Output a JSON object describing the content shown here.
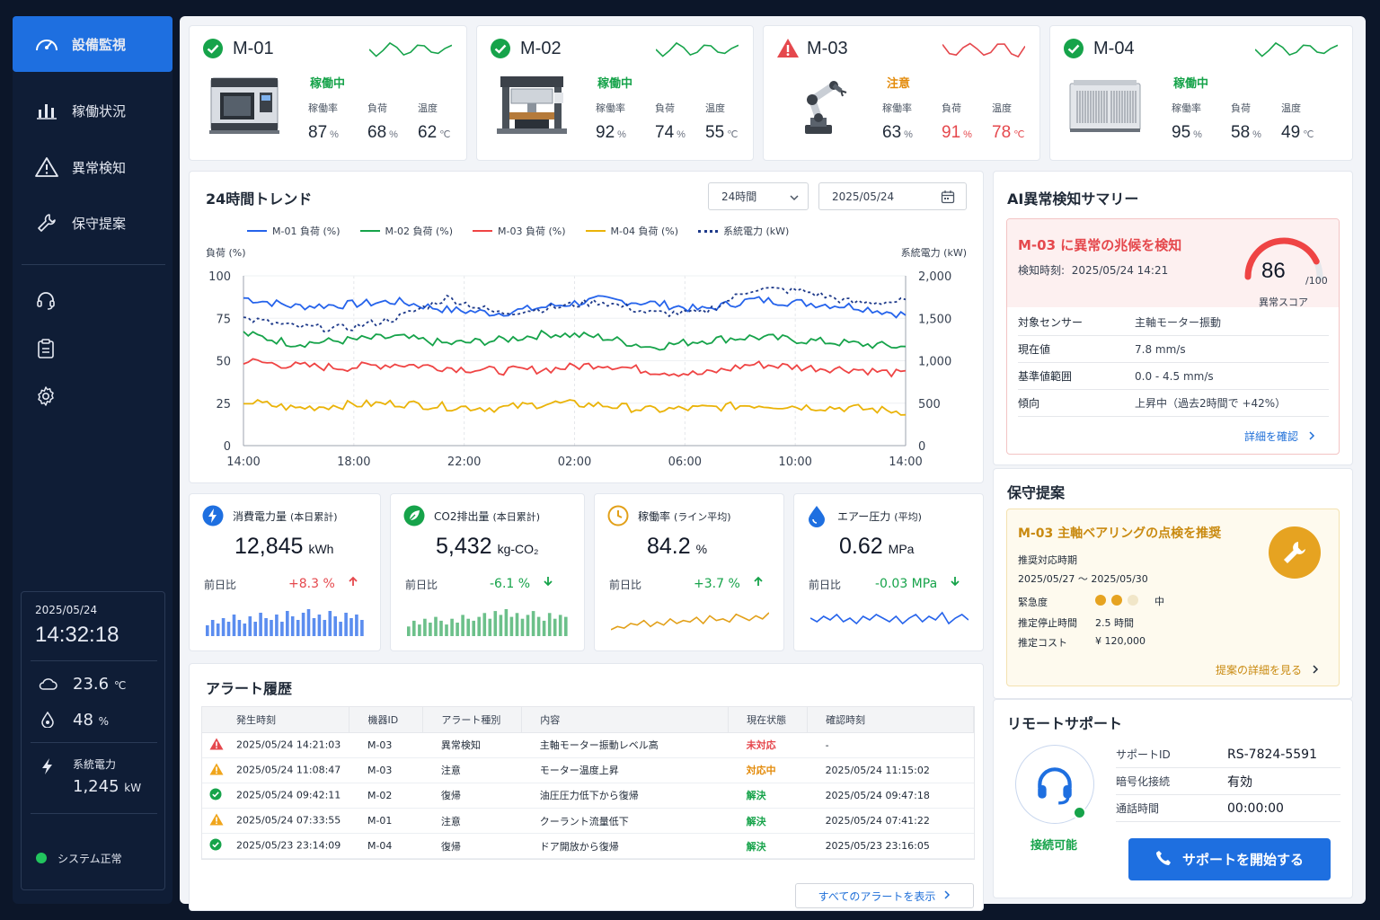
{
  "sidebar": {
    "nav": [
      {
        "label": "設備監視",
        "icon": "gauge-icon",
        "active": true
      },
      {
        "label": "稼働状況",
        "icon": "bar-chart-icon",
        "active": false
      },
      {
        "label": "異常検知",
        "icon": "warning-icon",
        "active": false
      },
      {
        "label": "保守提案",
        "icon": "wrench-icon",
        "active": false
      }
    ],
    "tools": [
      "headset-icon",
      "clipboard-icon",
      "gear-icon"
    ],
    "date": "2025/05/24",
    "time": "14:32:18",
    "temp_value": "23.6",
    "temp_unit": "℃",
    "humidity_value": "48",
    "humidity_unit": "%",
    "power_label": "系統電力",
    "power_value": "1,245",
    "power_unit": "kW",
    "system_status": "システム正常"
  },
  "machines": [
    {
      "id": "M-01",
      "status": "稼働中",
      "state": "ok",
      "utilization_label": "稼働率",
      "utilization": "87",
      "load_label": "負荷",
      "load": "68",
      "temp_label": "温度",
      "temp": "62",
      "pct": "%",
      "deg": "℃",
      "image": "cnc-machine"
    },
    {
      "id": "M-02",
      "status": "稼働中",
      "state": "ok",
      "utilization_label": "稼働率",
      "utilization": "92",
      "load_label": "負荷",
      "load": "74",
      "temp_label": "温度",
      "temp": "55",
      "pct": "%",
      "deg": "℃",
      "image": "press-machine"
    },
    {
      "id": "M-03",
      "status": "注意",
      "state": "warn",
      "utilization_label": "稼働率",
      "utilization": "63",
      "load_label": "負荷",
      "load": "91",
      "temp_label": "温度",
      "temp": "78",
      "pct": "%",
      "deg": "℃",
      "image": "robot-arm"
    },
    {
      "id": "M-04",
      "status": "稼働中",
      "state": "ok",
      "utilization_label": "稼働率",
      "utilization": "95",
      "load_label": "負荷",
      "load": "58",
      "temp_label": "温度",
      "temp": "49",
      "pct": "%",
      "deg": "℃",
      "image": "chiller-unit"
    }
  ],
  "trend": {
    "title": "24時間トレンド",
    "range_select": "24時間",
    "date_input": "2025/05/24",
    "left_axis_label": "負荷 (%)",
    "right_axis_label": "系統電力 (kW)",
    "legend": [
      "M-01 負荷 (%)",
      "M-02 負荷 (%)",
      "M-03 負荷 (%)",
      "M-04 負荷 (%)",
      "系統電力 (kW)"
    ],
    "left_ticks": [
      "100",
      "75",
      "50",
      "25",
      "0"
    ],
    "right_ticks": [
      "2,000",
      "1,500",
      "1,000",
      "500",
      "0"
    ],
    "x_ticks": [
      "14:00",
      "18:00",
      "22:00",
      "02:00",
      "06:00",
      "10:00",
      "14:00"
    ]
  },
  "chart_data": {
    "type": "line",
    "title": "24時間トレンド",
    "x": [
      "14:00",
      "18:00",
      "22:00",
      "02:00",
      "06:00",
      "10:00",
      "14:00"
    ],
    "ylabel": "負荷 (%)",
    "y2label": "系統電力 (kW)",
    "ylim": [
      0,
      100
    ],
    "y2lim": [
      0,
      2000
    ],
    "grid": true,
    "legend_position": "top",
    "series": [
      {
        "name": "M-01 負荷 (%)",
        "color": "#2563eb",
        "axis": "left",
        "values": [
          87,
          82,
          83,
          85,
          80,
          78,
          82,
          86,
          84,
          80,
          86,
          84,
          82,
          77
        ]
      },
      {
        "name": "M-02 負荷 (%)",
        "color": "#16a34a",
        "axis": "left",
        "values": [
          66,
          60,
          62,
          64,
          60,
          62,
          66,
          64,
          58,
          62,
          64,
          62,
          60,
          58
        ]
      },
      {
        "name": "M-03 負荷 (%)",
        "color": "#ef4444",
        "axis": "left",
        "values": [
          50,
          47,
          46,
          48,
          46,
          44,
          45,
          48,
          44,
          42,
          48,
          46,
          45,
          42
        ]
      },
      {
        "name": "M-04 負荷 (%)",
        "color": "#eab308",
        "axis": "left",
        "values": [
          26,
          22,
          24,
          25,
          23,
          22,
          25,
          24,
          21,
          22,
          24,
          23,
          22,
          20
        ]
      },
      {
        "name": "系統電力 (kW)",
        "color": "#1e3a8a",
        "axis": "right",
        "dashed": true,
        "values": [
          1500,
          1400,
          1380,
          1500,
          1740,
          1560,
          1620,
          1700,
          1560,
          1560,
          1850,
          1820,
          1680,
          1700
        ]
      }
    ]
  },
  "kpis": [
    {
      "title": "消費電力量",
      "sub": "(本日累計)",
      "value": "12,845",
      "unit": "kWh",
      "delta_label": "前日比",
      "delta": "+8.3 %",
      "dir": "up",
      "delta_color": "#e5484d",
      "icon": "bolt-icon",
      "icon_color": "#1e6fe0",
      "spark": "bars",
      "spark_color": "#5b8def",
      "spark_values": [
        6,
        9,
        7,
        10,
        8,
        12,
        9,
        7,
        11,
        8,
        13,
        10,
        9,
        12,
        8,
        14,
        11,
        9,
        13,
        15,
        10,
        12,
        9,
        14,
        11,
        8,
        13,
        10,
        12,
        9
      ]
    },
    {
      "title": "CO2排出量",
      "sub": "(本日累計)",
      "value": "5,432",
      "unit": "kg-CO₂",
      "delta_label": "前日比",
      "delta": "-6.1 %",
      "dir": "down",
      "delta_color": "#16a34a",
      "icon": "leaf-icon",
      "icon_color": "#16a34a",
      "spark": "bars",
      "spark_color": "#6cc08a",
      "spark_values": [
        5,
        8,
        6,
        9,
        7,
        10,
        8,
        6,
        9,
        7,
        11,
        9,
        8,
        10,
        12,
        9,
        13,
        11,
        14,
        10,
        12,
        9,
        11,
        13,
        10,
        8,
        12,
        9,
        11,
        10
      ]
    },
    {
      "title": "稼働率",
      "sub": "(ライン平均)",
      "value": "84.2",
      "unit": "%",
      "delta_label": "前日比",
      "delta": "+3.7 %",
      "dir": "up",
      "delta_color": "#16a34a",
      "icon": "clock-icon",
      "icon_color": "#e2a019",
      "spark": "line",
      "spark_color": "#e2a019",
      "spark_values": [
        3,
        5,
        4,
        7,
        6,
        9,
        5,
        8,
        6,
        10,
        7,
        9,
        8,
        11,
        7,
        12,
        9,
        10,
        8,
        13,
        11,
        9,
        12,
        10,
        14
      ]
    },
    {
      "title": "エアー圧力",
      "sub": "(平均)",
      "value": "0.62",
      "unit": "MPa",
      "delta_label": "前日比",
      "delta": "-0.03 MPa",
      "dir": "down",
      "delta_color": "#16a34a",
      "icon": "drop-icon",
      "icon_color": "#1e6fe0",
      "spark": "line",
      "spark_color": "#2563eb",
      "spark_values": [
        9,
        7,
        10,
        8,
        11,
        7,
        9,
        6,
        10,
        8,
        11,
        9,
        7,
        10,
        6,
        9,
        11,
        7,
        10,
        8,
        12,
        6,
        9,
        11,
        8
      ]
    }
  ],
  "alerts": {
    "title": "アラート履歴",
    "columns": [
      "発生時刻",
      "機器ID",
      "アラート種別",
      "内容",
      "現在状態",
      "確認時刻"
    ],
    "rows": [
      {
        "level": "error",
        "time": "2025/05/24 14:21:03",
        "id": "M-03",
        "type": "異常検知",
        "content": "主軸モーター振動レベル高",
        "state": "未対応",
        "state_color": "#e5484d",
        "confirmed": "-"
      },
      {
        "level": "warn",
        "time": "2025/05/24 11:08:47",
        "id": "M-03",
        "type": "注意",
        "content": "モーター温度上昇",
        "state": "対応中",
        "state_color": "#e38b0b",
        "confirmed": "2025/05/24 11:15:02"
      },
      {
        "level": "ok",
        "time": "2025/05/24 09:42:11",
        "id": "M-02",
        "type": "復帰",
        "content": "油圧圧力低下から復帰",
        "state": "解決",
        "state_color": "#16a34a",
        "confirmed": "2025/05/24 09:47:18"
      },
      {
        "level": "warn",
        "time": "2025/05/24 07:33:55",
        "id": "M-01",
        "type": "注意",
        "content": "クーラント流量低下",
        "state": "解決",
        "state_color": "#16a34a",
        "confirmed": "2025/05/24 07:41:22"
      },
      {
        "level": "ok",
        "time": "2025/05/23 23:14:09",
        "id": "M-04",
        "type": "復帰",
        "content": "ドア開放から復帰",
        "state": "解決",
        "state_color": "#16a34a",
        "confirmed": "2025/05/23 23:16:05"
      }
    ],
    "view_all": "すべてのアラートを表示"
  },
  "ai": {
    "title": "AI異常検知サマリー",
    "headline": "M-03 に異常の兆候を検知",
    "detect_label": "検知時刻:",
    "detect_time": "2025/05/24 14:21",
    "score": "86",
    "score_value": 86,
    "score_max": "/100",
    "score_label": "異常スコア",
    "rows": [
      {
        "k": "対象センサー",
        "v": "主軸モーター振動"
      },
      {
        "k": "現在値",
        "v": "7.8 mm/s"
      },
      {
        "k": "基準値範囲",
        "v": "0.0 - 4.5 mm/s"
      },
      {
        "k": "傾向",
        "v": "上昇中（過去2時間で +42%）"
      }
    ],
    "detail_link": "詳細を確認"
  },
  "maintenance": {
    "title": "保守提案",
    "headline": "M-03 主軸ベアリングの点検を推奨",
    "period_label": "推奨対応時期",
    "period": "2025/05/27 〜 2025/05/30",
    "urgency_label": "緊急度",
    "urgency_level": 2,
    "urgency_of": 3,
    "urgency_text": "中",
    "downtime_label": "推定停止時間",
    "downtime": "2.5 時間",
    "cost_label": "推定コスト",
    "cost": "¥ 120,000",
    "detail_link": "提案の詳細を見る"
  },
  "remote": {
    "title": "リモートサポート",
    "status": "接続可能",
    "rows": [
      {
        "k": "サポートID",
        "v": "RS-7824-5591"
      },
      {
        "k": "暗号化接続",
        "v": "有効"
      },
      {
        "k": "通話時間",
        "v": "00:00:00"
      }
    ],
    "button": "サポートを開始する"
  }
}
